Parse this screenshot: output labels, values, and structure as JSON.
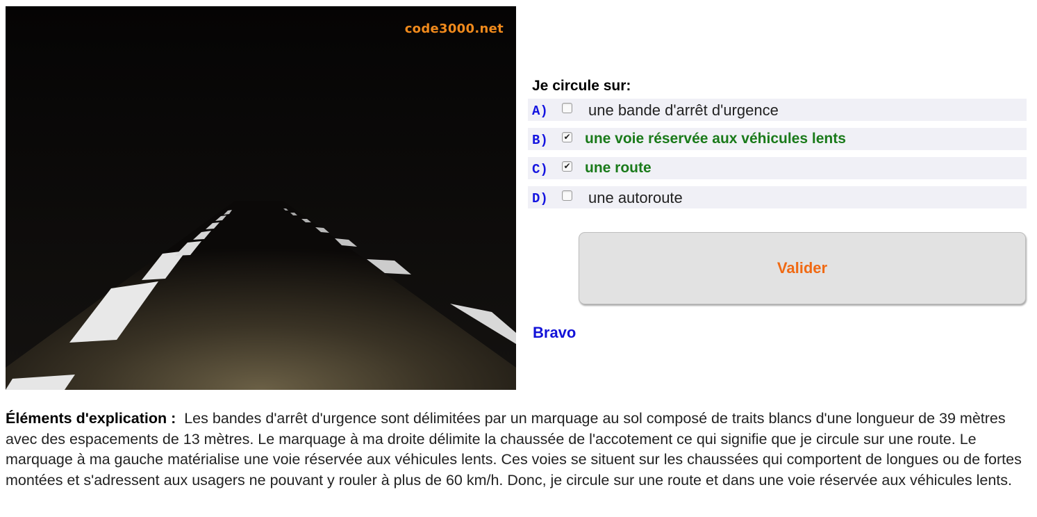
{
  "image": {
    "watermark": "code3000.net"
  },
  "question": {
    "title": "Je circule sur:"
  },
  "answers": [
    {
      "letter": "A)",
      "text": "une bande d'arrêt d'urgence",
      "checked": false
    },
    {
      "letter": "B)",
      "text": "une voie réservée aux véhicules lents",
      "checked": true
    },
    {
      "letter": "C)",
      "text": "une route",
      "checked": true
    },
    {
      "letter": "D)",
      "text": "une autoroute",
      "checked": false
    }
  ],
  "submit": {
    "label": "Valider"
  },
  "feedback": {
    "text": "Bravo"
  },
  "explanation": {
    "label": "Éléments d'explication :",
    "text": "Les bandes d'arrêt d'urgence sont délimitées par un marquage au sol composé de traits blancs d'une longueur de 39 mètres avec des espacements de 13 mètres. Le marquage à ma droite délimite la chaussée de l'accotement ce qui signifie que je circule sur une route. Le marquage à ma gauche matérialise une voie réservée aux véhicules lents. Ces voies se situent sur les chaussées qui comportent de longues ou de fortes montées et s'adressent aux usagers ne pouvant y rouler à plus de 60 km/h. Donc, je circule sur une route et dans une voie réservée aux véhicules lents."
  },
  "colors": {
    "answer_label": "#1515e0",
    "correct_answer": "#1a7a1a",
    "submit_text": "#f06a14",
    "feedback": "#1212d8",
    "watermark": "#f08a1c"
  }
}
